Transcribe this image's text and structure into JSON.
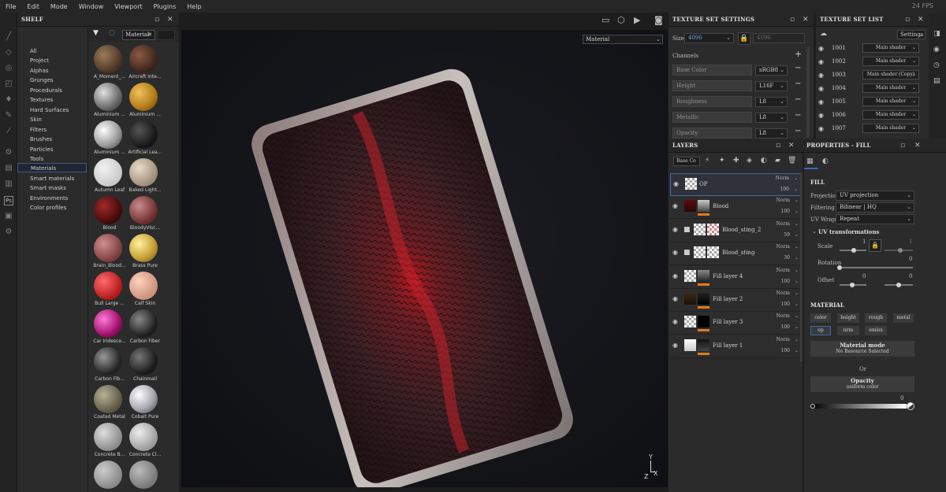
{
  "menu": {
    "items": [
      "File",
      "Edit",
      "Mode",
      "Window",
      "Viewport",
      "Plugins",
      "Help"
    ],
    "fps": "24 FPS"
  },
  "shelf": {
    "title": "SHELF",
    "categories": [
      "All",
      "Project",
      "Alphas",
      "Grunges",
      "Procedurals",
      "Textures",
      "Hard Surfaces",
      "Skin",
      "Filters",
      "Brushes",
      "Particles",
      "Tools",
      "Materials",
      "Smart materials",
      "Smart masks",
      "Environments",
      "Color profiles"
    ],
    "selected_category": "Materials",
    "filter_tag": "Material",
    "materials": [
      {
        "label": "A_Moment_...",
        "color": "radial-gradient(circle at 35% 35%,#9a7b5a,#4a3323 70%)"
      },
      {
        "label": "Aircraft Inte...",
        "color": "radial-gradient(circle at 35% 35%,#8a5a45,#3a2218 70%)"
      },
      {
        "label": "Aluminium ...",
        "color": "radial-gradient(circle at 35% 35%,#e0e0e0,#6a6a6a 60%,#2a2a2a)"
      },
      {
        "label": "Aluminium ...",
        "color": "radial-gradient(circle at 35% 35%,#f2c15a,#b07a18 60%,#5a3a08)"
      },
      {
        "label": "Aluminium ...",
        "color": "radial-gradient(circle at 35% 35%,#ffffff,#a0a0a0 55%,#3a3a3a)"
      },
      {
        "label": "Artificial Lea...",
        "color": "radial-gradient(circle at 35% 35%,#555,#161616 65%)"
      },
      {
        "label": "Autumn Leaf",
        "color": "radial-gradient(circle at 35% 35%,#f2f2f2,#c9c9c9 70%)"
      },
      {
        "label": "Baked Light...",
        "color": "radial-gradient(circle at 35% 35%,#e8dcc8,#9c8c78 70%)"
      },
      {
        "label": "Blood",
        "color": "radial-gradient(circle at 35% 35%,#a02a2a,#3e0808 70%)"
      },
      {
        "label": "BloodyVisc...",
        "color": "radial-gradient(circle at 35% 35%,#c88a8a,#6a2a2a 70%)"
      },
      {
        "label": "Brain_Blood...",
        "color": "radial-gradient(circle at 35% 35%,#d09090,#7a3a3a 70%)"
      },
      {
        "label": "Brass Pure",
        "color": "radial-gradient(circle at 35% 35%,#fff3a0,#c9a23a 55%,#6a4e10)"
      },
      {
        "label": "Bull Large ...",
        "color": "radial-gradient(circle at 35% 35%,#ff6a6a,#b01818 70%)"
      },
      {
        "label": "Calf Skin",
        "color": "radial-gradient(circle at 35% 35%,#ffd2bc,#c9907a 70%)"
      },
      {
        "label": "Car Iridesce...",
        "color": "radial-gradient(circle at 35% 35%,#ff7ad8,#a0106a 60%,#400030)"
      },
      {
        "label": "Carbon Fiber",
        "color": "radial-gradient(circle at 35% 35%,#888,#1e1e1e 65%)"
      },
      {
        "label": "Carbon Fib...",
        "color": "radial-gradient(circle at 35% 35%,#999,#222 65%)"
      },
      {
        "label": "Chainmail",
        "color": "radial-gradient(circle at 35% 35%,#777,#1a1a1a 65%)"
      },
      {
        "label": "Coated Metal",
        "color": "radial-gradient(circle at 35% 35%,#b8b098,#5a5440 70%)"
      },
      {
        "label": "Cobalt Pure",
        "color": "radial-gradient(circle at 35% 35%,#ffffff,#a8a8b0 55%,#3a3a44)"
      },
      {
        "label": "Concrete B...",
        "color": "radial-gradient(circle at 35% 35%,#ddd,#8a8a8a 70%)"
      },
      {
        "label": "Concrete Cl...",
        "color": "radial-gradient(circle at 35% 35%,#eee,#9a9a9a 70%)"
      },
      {
        "label": "",
        "color": "radial-gradient(circle at 35% 35%,#ccc,#888 70%)"
      },
      {
        "label": "",
        "color": "radial-gradient(circle at 35% 35%,#bbb,#777 70%)"
      }
    ]
  },
  "viewport": {
    "mode": "Material",
    "axis": {
      "y": "Y",
      "z": "Z",
      "x": "X"
    }
  },
  "texture_set_settings": {
    "title": "TEXTURE SET SETTINGS",
    "size_label": "Size",
    "size_value": "4096",
    "size_linked": "4096",
    "channels_label": "Channels",
    "channels": [
      {
        "name": "Base Color",
        "format": "sRGB8"
      },
      {
        "name": "Height",
        "format": "L16F"
      },
      {
        "name": "Roughness",
        "format": "L8"
      },
      {
        "name": "Metallic",
        "format": "L8"
      },
      {
        "name": "Opacity",
        "format": "L8"
      }
    ]
  },
  "texture_set_list": {
    "title": "TEXTURE SET LIST",
    "settings_label": "Settings",
    "rows": [
      {
        "num": "1001",
        "shader": "Main shader"
      },
      {
        "num": "1002",
        "shader": "Main shader"
      },
      {
        "num": "1003",
        "shader": "Main shader (Copy)"
      },
      {
        "num": "1004",
        "shader": "Main shader"
      },
      {
        "num": "1005",
        "shader": "Main shader"
      },
      {
        "num": "1006",
        "shader": "Main shader"
      },
      {
        "num": "1007",
        "shader": "Main shader"
      }
    ]
  },
  "layers": {
    "title": "LAYERS",
    "channel_select": "Base Co",
    "items": [
      {
        "name": "OP",
        "blend": "Norm",
        "opacity": "100",
        "group": false
      },
      {
        "name": "Blood",
        "blend": "Norm",
        "opacity": "100",
        "group": false
      },
      {
        "name": "Blood_sting_2",
        "blend": "Norm",
        "opacity": "59",
        "group": true
      },
      {
        "name": "Blood_sting",
        "blend": "Norm",
        "opacity": "30",
        "group": true
      },
      {
        "name": "Fill layer 4",
        "blend": "Norm",
        "opacity": "100",
        "group": false
      },
      {
        "name": "Fill layer 2",
        "blend": "Norm",
        "opacity": "100",
        "group": false
      },
      {
        "name": "Fill layer 3",
        "blend": "Norm",
        "opacity": "100",
        "group": false
      },
      {
        "name": "Fill layer 1",
        "blend": "Norm",
        "opacity": "100",
        "group": false
      }
    ]
  },
  "properties": {
    "title": "PROPERTIES - FILL",
    "fill_label": "FILL",
    "projection_label": "Projection",
    "projection_value": "UV projection",
    "filtering_label": "Filtering",
    "filtering_value": "Bilinear | HQ",
    "uvwrap_label": "UV Wrap",
    "uvwrap_value": "Repeat",
    "uvtrans_label": "UV transformations",
    "scale_label": "Scale",
    "scale_u": "1",
    "scale_v": "1",
    "rotation_label": "Rotation",
    "rotation_value": "0",
    "offset_label": "Offset",
    "offset_u": "0",
    "offset_v": "0",
    "material_label": "MATERIAL",
    "mat_buttons": [
      "color",
      "height",
      "rough",
      "metal",
      "op",
      "nrm",
      "emiss"
    ],
    "material_mode_label": "Material mode",
    "material_mode_sub": "No Resource Selected",
    "or_label": "Or",
    "opacity_label": "Opacity",
    "opacity_sub": "uniform color",
    "opacity_value": "0"
  }
}
